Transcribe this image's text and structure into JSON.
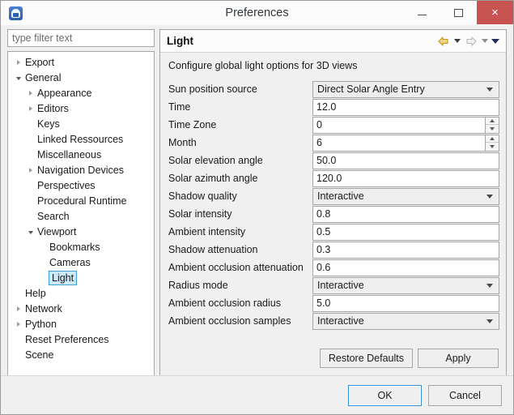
{
  "window": {
    "title": "Preferences",
    "app_icon": "app-icon",
    "controls": {
      "minimize": "minimize-icon",
      "maximize": "maximize-icon",
      "close": "×"
    }
  },
  "filter": {
    "placeholder": "type filter text",
    "value": ""
  },
  "tree": {
    "items": [
      {
        "label": "Export",
        "indent": 0,
        "twisty": "closed",
        "selected": false
      },
      {
        "label": "General",
        "indent": 0,
        "twisty": "open",
        "selected": false
      },
      {
        "label": "Appearance",
        "indent": 1,
        "twisty": "closed",
        "selected": false
      },
      {
        "label": "Editors",
        "indent": 1,
        "twisty": "closed",
        "selected": false
      },
      {
        "label": "Keys",
        "indent": 1,
        "twisty": "none",
        "selected": false
      },
      {
        "label": "Linked Ressources",
        "indent": 1,
        "twisty": "none",
        "selected": false
      },
      {
        "label": "Miscellaneous",
        "indent": 1,
        "twisty": "none",
        "selected": false
      },
      {
        "label": "Navigation Devices",
        "indent": 1,
        "twisty": "closed",
        "selected": false
      },
      {
        "label": "Perspectives",
        "indent": 1,
        "twisty": "none",
        "selected": false
      },
      {
        "label": "Procedural Runtime",
        "indent": 1,
        "twisty": "none",
        "selected": false
      },
      {
        "label": "Search",
        "indent": 1,
        "twisty": "none",
        "selected": false
      },
      {
        "label": "Viewport",
        "indent": 1,
        "twisty": "open",
        "selected": false
      },
      {
        "label": "Bookmarks",
        "indent": 2,
        "twisty": "none",
        "selected": false
      },
      {
        "label": "Cameras",
        "indent": 2,
        "twisty": "none",
        "selected": false
      },
      {
        "label": "Light",
        "indent": 2,
        "twisty": "none",
        "selected": true
      },
      {
        "label": "Help",
        "indent": 0,
        "twisty": "none",
        "selected": false
      },
      {
        "label": "Network",
        "indent": 0,
        "twisty": "closed",
        "selected": false
      },
      {
        "label": "Python",
        "indent": 0,
        "twisty": "closed",
        "selected": false
      },
      {
        "label": "Reset Preferences",
        "indent": 0,
        "twisty": "none",
        "selected": false
      },
      {
        "label": "Scene",
        "indent": 0,
        "twisty": "none",
        "selected": false
      }
    ]
  },
  "page": {
    "title": "Light",
    "description": "Configure global light options for 3D views",
    "nav": {
      "back_icon": "back-arrow-icon",
      "back_menu_icon": "back-dropdown-icon",
      "forward_icon": "forward-arrow-icon",
      "forward_menu_icon": "forward-dropdown-icon",
      "view_menu_icon": "view-menu-icon",
      "back_color": "#d9a513",
      "forward_color": "#cfcfcf"
    },
    "fields": [
      {
        "label": "Sun position source",
        "type": "combo",
        "value": "Direct Solar Angle Entry"
      },
      {
        "label": "Time",
        "type": "text",
        "value": "12.0"
      },
      {
        "label": "Time Zone",
        "type": "spinner",
        "value": "0"
      },
      {
        "label": "Month",
        "type": "spinner",
        "value": "6"
      },
      {
        "label": "Solar elevation angle",
        "type": "text",
        "value": "50.0"
      },
      {
        "label": "Solar azimuth angle",
        "type": "text",
        "value": "120.0"
      },
      {
        "label": "Shadow quality",
        "type": "combo",
        "value": "Interactive"
      },
      {
        "label": "Solar intensity",
        "type": "text",
        "value": "0.8"
      },
      {
        "label": "Ambient intensity",
        "type": "text",
        "value": "0.5"
      },
      {
        "label": "Shadow attenuation",
        "type": "text",
        "value": "0.3"
      },
      {
        "label": "Ambient occlusion attenuation",
        "type": "text",
        "value": "0.6"
      },
      {
        "label": "Radius mode",
        "type": "combo",
        "value": "Interactive"
      },
      {
        "label": "Ambient occlusion radius",
        "type": "text",
        "value": "5.0"
      },
      {
        "label": "Ambient occlusion samples",
        "type": "combo",
        "value": "Interactive"
      }
    ],
    "restore_defaults_label": "Restore Defaults",
    "apply_label": "Apply"
  },
  "footer": {
    "ok_label": "OK",
    "cancel_label": "Cancel"
  }
}
